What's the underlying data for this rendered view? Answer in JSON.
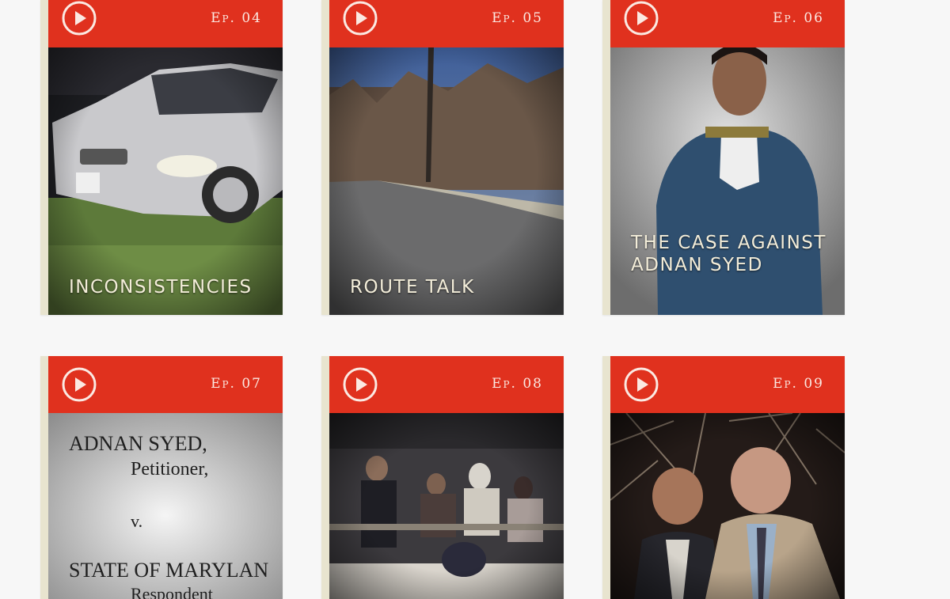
{
  "episodes": [
    {
      "ep_label": "Ep. 04",
      "title": "Inconsistencies",
      "image": "silver-sedan-on-grass"
    },
    {
      "ep_label": "Ep. 05",
      "title": "Route Talk",
      "image": "road-through-bare-woods"
    },
    {
      "ep_label": "Ep. 06",
      "title": "The Case Against Adnan Syed",
      "image": "portrait-young-man-blue-jacket"
    },
    {
      "ep_label": "Ep. 07",
      "title": "",
      "image": "court-document",
      "document_lines": [
        "ADNAN SYED,",
        "Petitioner,",
        "v.",
        "STATE OF MARYLAN",
        "Respondent"
      ]
    },
    {
      "ep_label": "Ep. 08",
      "title": "",
      "image": "courtroom-gathering"
    },
    {
      "ep_label": "Ep. 09",
      "title": "",
      "image": "two-men-in-woods-night"
    }
  ],
  "colors": {
    "accent_red": "#e0311e",
    "card_edge": "#e8e4cf",
    "title_text": "#f3edd9"
  },
  "icons": {
    "play": "play-circle-icon"
  }
}
